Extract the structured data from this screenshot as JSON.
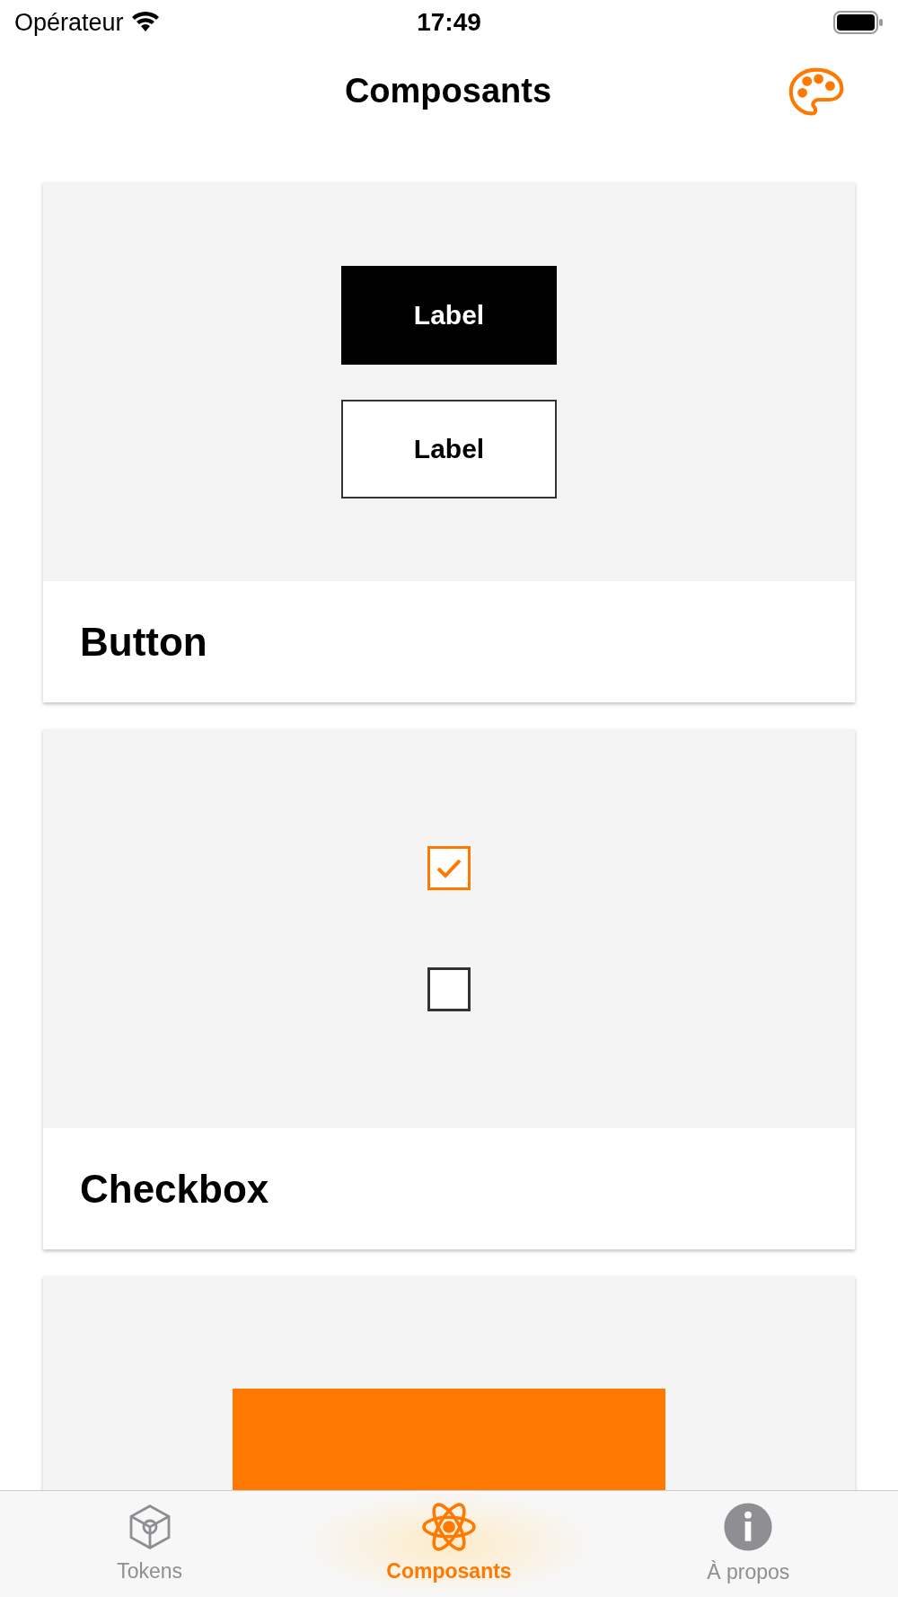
{
  "status_bar": {
    "carrier": "Opérateur",
    "time": "17:49"
  },
  "nav": {
    "title": "Composants"
  },
  "cards": [
    {
      "kind": "buttons",
      "title": "Button",
      "buttons": [
        {
          "label": "Label",
          "kind": "filled"
        },
        {
          "label": "Label",
          "kind": "outlined"
        }
      ]
    },
    {
      "kind": "checkboxes",
      "title": "Checkbox",
      "checkboxes": [
        {
          "checked": true
        },
        {
          "checked": false
        }
      ]
    },
    {
      "kind": "block"
    }
  ],
  "tabs": [
    {
      "label": "Tokens",
      "kind": "cube",
      "selected": false
    },
    {
      "label": "Composants",
      "kind": "atom",
      "selected": true
    },
    {
      "label": "À propos",
      "kind": "info",
      "selected": false
    }
  ]
}
